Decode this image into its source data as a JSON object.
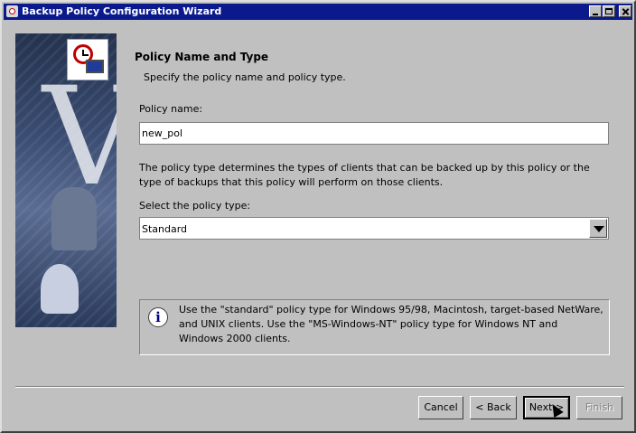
{
  "window": {
    "title": "Backup Policy Configuration Wizard"
  },
  "page": {
    "heading": "Policy Name and Type",
    "subheading": "Specify the policy name and policy type."
  },
  "policy_name": {
    "label": "Policy name:",
    "value": "new_pol"
  },
  "description": "The policy type determines the types of clients that can be backed up by this policy or the type of backups that this policy will perform on those clients.",
  "policy_type": {
    "label": "Select the policy type:",
    "selected": "Standard"
  },
  "info": {
    "text": "Use the \"standard\" policy type for Windows 95/98, Macintosh, target-based NetWare, and UNIX clients. Use the \"MS-Windows-NT\" policy type for Windows NT and Windows 2000 clients."
  },
  "buttons": {
    "cancel": "Cancel",
    "back": "< Back",
    "next": "Next >",
    "finish": "Finish"
  },
  "colors": {
    "titlebar": "#0a1a8c",
    "window_bg": "#c0c0c0"
  }
}
